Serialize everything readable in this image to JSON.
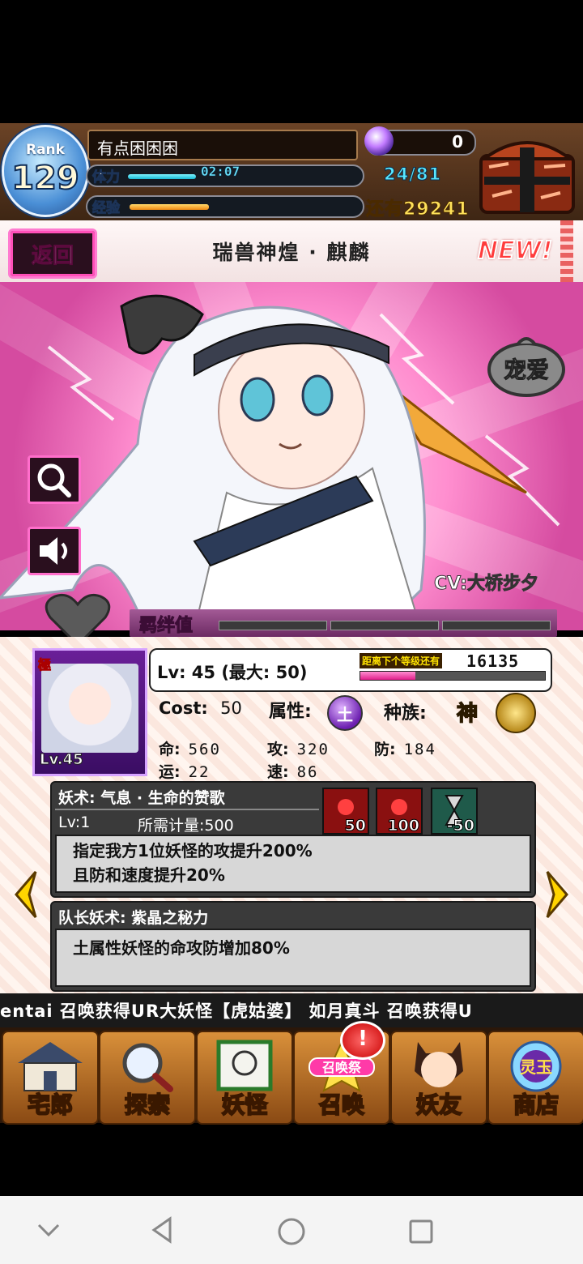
{
  "player": {
    "rank_label": "Rank",
    "rank": "129",
    "name": "有点困困困",
    "stamina_label": "体力",
    "stamina_timer": "02:07",
    "stamina_count": "24/81",
    "stamina_fraction": 0.3,
    "exp_label": "经验",
    "exp_fraction": 0.35,
    "exp_remaining": "还有29241",
    "orb_count": "0"
  },
  "header": {
    "back_label": "返回",
    "title": "瑞兽神煌 · 麒麟",
    "new_badge": "NEW!"
  },
  "art": {
    "favor_label": "宠爱",
    "cv_label": "CV:大桥步夕"
  },
  "bond": {
    "label": "羁绊值",
    "filled_segments": 0,
    "total_segments": 3
  },
  "monster": {
    "portrait_rank": "極",
    "portrait_level": "Lv.45",
    "level_text": "Lv: 45 (最大: 50)",
    "next_label": "距离下个等级还有",
    "next_value": "16135",
    "next_fraction": 0.3,
    "cost_label": "Cost:",
    "cost_value": "50",
    "attr_label": "属性:",
    "attr_glyph": "土",
    "race_label": "种族:",
    "race_value": "神",
    "stats": {
      "hp_label": "命:",
      "hp": "560",
      "atk_label": "攻:",
      "atk": "320",
      "def_label": "防:",
      "def": "184",
      "luck_label": "运:",
      "luck": "22",
      "spd_label": "速:",
      "spd": "86"
    }
  },
  "skill": {
    "title": "妖术: 气息 · 生命的赞歌",
    "level": "Lv:1",
    "gauge": "所需计量:500",
    "costs": [
      "50",
      "100",
      "-50"
    ],
    "desc_line1": "指定我方1位妖怪的攻提升200%",
    "desc_line2": "且防和速度提升20%"
  },
  "leader_skill": {
    "title": "队长妖术: 紫晶之秘力",
    "desc": "土属性妖怪的命攻防增加80%"
  },
  "ticker": {
    "text": "entai 召唤获得UR大妖怪【虎姑婆】      如月真斗 召唤获得U"
  },
  "nav": {
    "items": [
      {
        "label": "宅郎",
        "icon": "house-icon"
      },
      {
        "label": "探索",
        "icon": "magnifier-icon"
      },
      {
        "label": "妖怪",
        "icon": "scroll-icon"
      },
      {
        "label": "召唤",
        "icon": "summon-icon",
        "badge": "召唤祭"
      },
      {
        "label": "妖友",
        "icon": "friend-icon"
      },
      {
        "label": "商店",
        "icon": "shop-orb-icon",
        "badge": "灵玉"
      }
    ],
    "alert": "!"
  },
  "colors": {
    "accent_pink": "#ff4fb8",
    "stamina_cyan": "#58e8ff",
    "exp_orange": "#f08a14",
    "panel_dark": "#3a3a3a"
  }
}
